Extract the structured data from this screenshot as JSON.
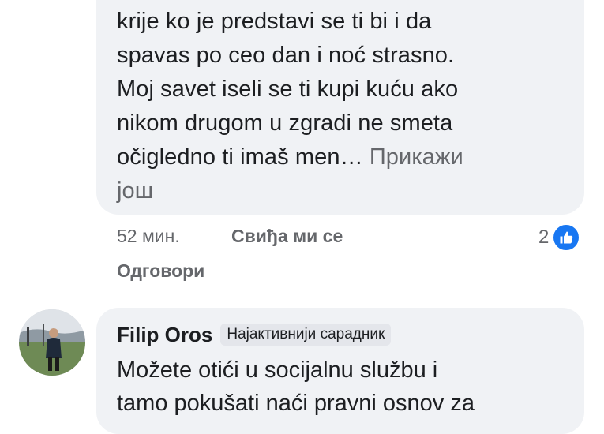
{
  "comment1": {
    "lines": [
      "krije ko je predstavi se ti bi i da",
      "spavas po ceo dan i noć strasno.",
      "Moj savet iseli se ti kupi kuću ako",
      "nikom drugom u zgradi ne smeta",
      "očigledno ti imaš men…"
    ],
    "see_more": "Прикажи још",
    "see_more_part1": "Прикажи",
    "see_more_part2": "још",
    "time": "52 мин.",
    "like_label": "Свиђа ми се",
    "reply_label": "Одговори",
    "reaction_count": "2",
    "reaction_icon": "thumbs-up-icon",
    "reaction_color": "#1877f2"
  },
  "comment2": {
    "author": "Filip Oros",
    "badge": "Најактивнији сарадник",
    "lines": [
      "Možete otići u socijalnu službu i",
      "tamo pokušati naći pravni osnov za"
    ]
  },
  "colors": {
    "bubble": "#f0f2f5",
    "meta_text": "#65676b",
    "text": "#1c1e21",
    "accent": "#1877f2"
  }
}
